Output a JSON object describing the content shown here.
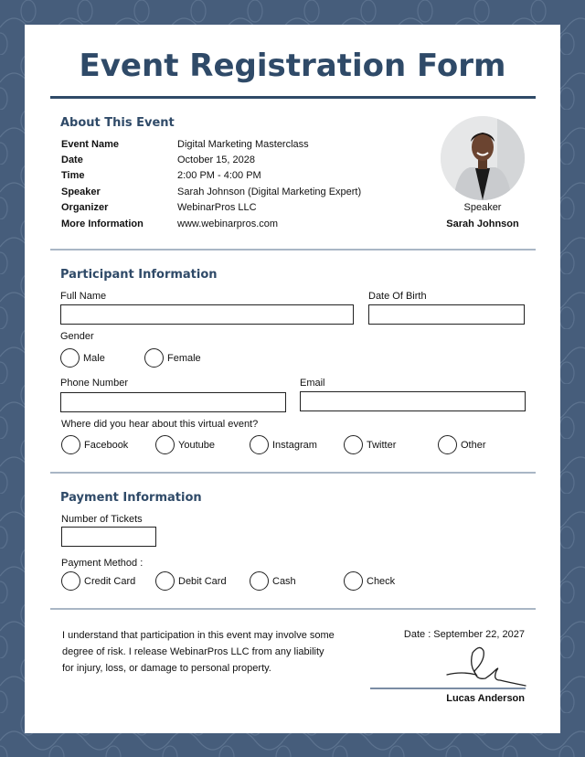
{
  "title": "Event Registration Form",
  "colors": {
    "background": "#465d7b",
    "accent": "#2f4a68",
    "divider": "#a9b6c5"
  },
  "about": {
    "heading": "About This Event",
    "rows": [
      {
        "label": "Event Name",
        "value": "Digital Marketing Masterclass"
      },
      {
        "label": "Date",
        "value": "October 15, 2028"
      },
      {
        "label": "Time",
        "value": "2:00 PM - 4:00 PM"
      },
      {
        "label": "Speaker",
        "value": "Sarah Johnson (Digital Marketing Expert)"
      },
      {
        "label": "Organizer",
        "value": "WebinarPros LLC"
      },
      {
        "label": "More Information",
        "value": "www.webinarpros.com"
      }
    ],
    "speaker_card": {
      "photo_icon": "speaker-photo",
      "role": "Speaker",
      "name": "Sarah Johnson"
    }
  },
  "participant": {
    "heading": "Participant Information",
    "full_name": {
      "label": "Full Name",
      "value": ""
    },
    "dob": {
      "label": "Date Of Birth",
      "value": ""
    },
    "gender": {
      "label": "Gender",
      "options": [
        "Male",
        "Female"
      ]
    },
    "phone": {
      "label": "Phone Number",
      "value": ""
    },
    "email": {
      "label": "Email",
      "value": ""
    },
    "source": {
      "label": "Where did you hear about this virtual event?",
      "options": [
        "Facebook",
        "Youtube",
        "Instagram",
        "Twitter",
        "Other"
      ]
    }
  },
  "payment": {
    "heading": "Payment Information",
    "tickets": {
      "label": "Number of Tickets",
      "value": ""
    },
    "method": {
      "label": "Payment Method :",
      "options": [
        "Credit Card",
        "Debit Card",
        "Cash",
        "Check"
      ]
    }
  },
  "consent": {
    "lines": [
      "I understand that participation in this event may involve some",
      "degree of risk. I release WebinarPros LLC from any liability",
      "for injury, loss, or damage to personal property."
    ],
    "date_text": "Date : September 22, 2027",
    "signature_icon": "signature",
    "signer": "Lucas Anderson"
  }
}
